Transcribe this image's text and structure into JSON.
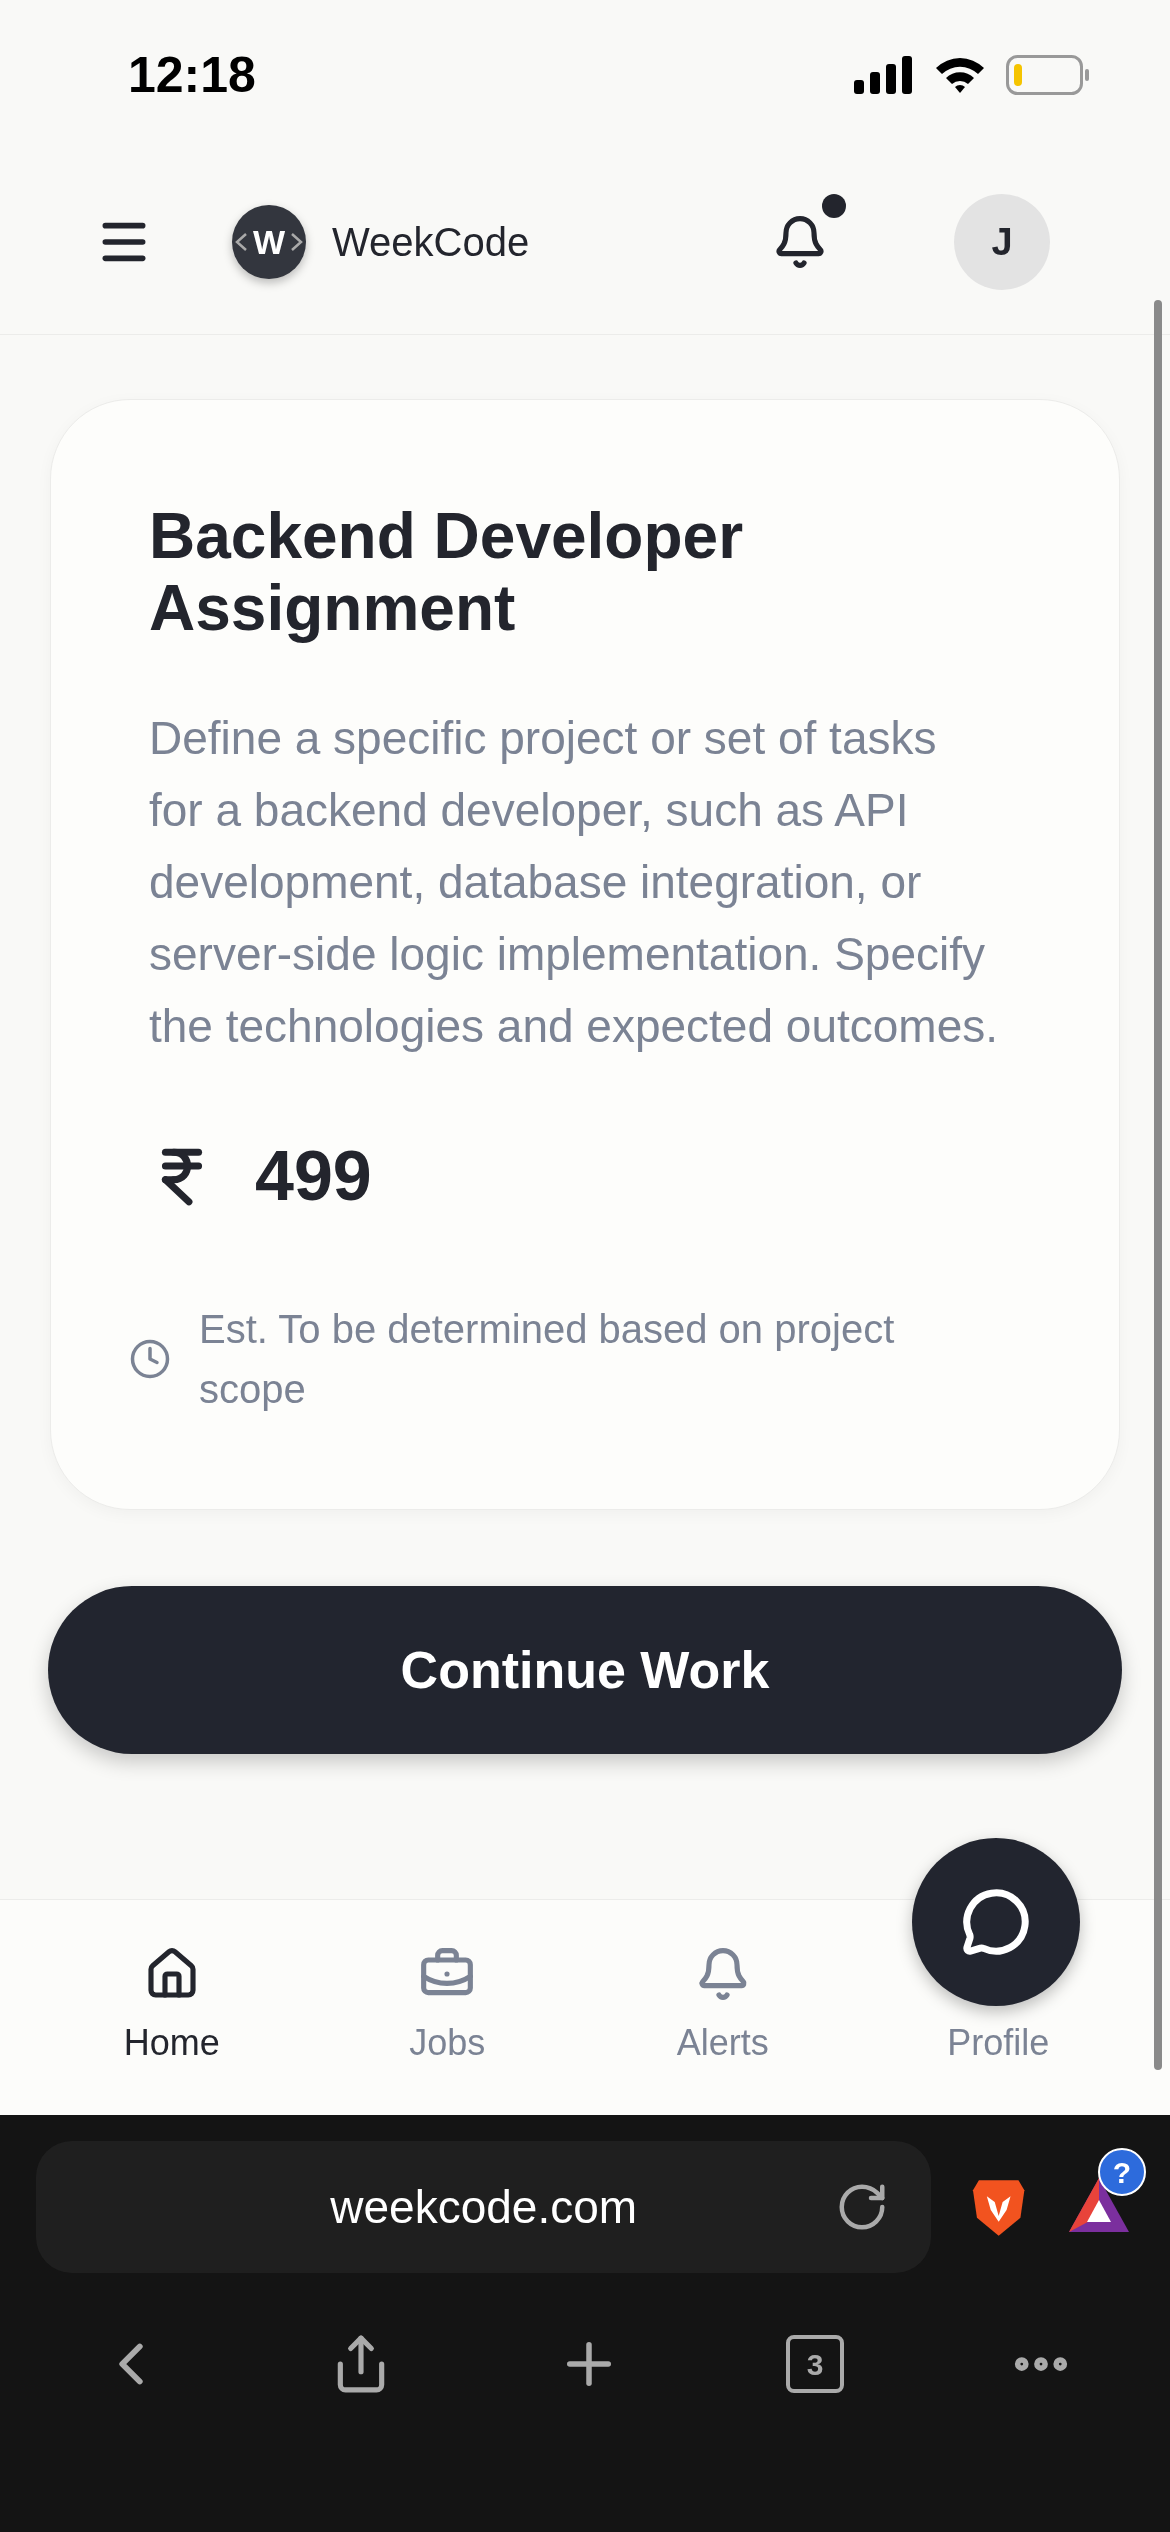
{
  "status_bar": {
    "time": "12:18"
  },
  "header": {
    "logo_letter": "W",
    "brand": "WeekCode",
    "notification_unread": true,
    "avatar_initial": "J"
  },
  "card": {
    "title": "Backend Developer Assignment",
    "description": "Define a specific project or set of tasks for a backend developer, such as API development, database integration, or server-side logic implementation. Specify the technologies and expected outcomes.",
    "price": "499",
    "estimate": "Est. To be determined based on project scope"
  },
  "primary_button": "Continue Work",
  "bottom_nav": [
    {
      "kind": "home",
      "label": "Home",
      "selected": true
    },
    {
      "kind": "jobs",
      "label": "Jobs",
      "selected": false
    },
    {
      "kind": "alerts",
      "label": "Alerts",
      "selected": false
    },
    {
      "kind": "profile",
      "label": "Profile",
      "selected": false
    }
  ],
  "browser": {
    "url": "weekcode.com",
    "tab_count": "3",
    "badge": "?"
  }
}
